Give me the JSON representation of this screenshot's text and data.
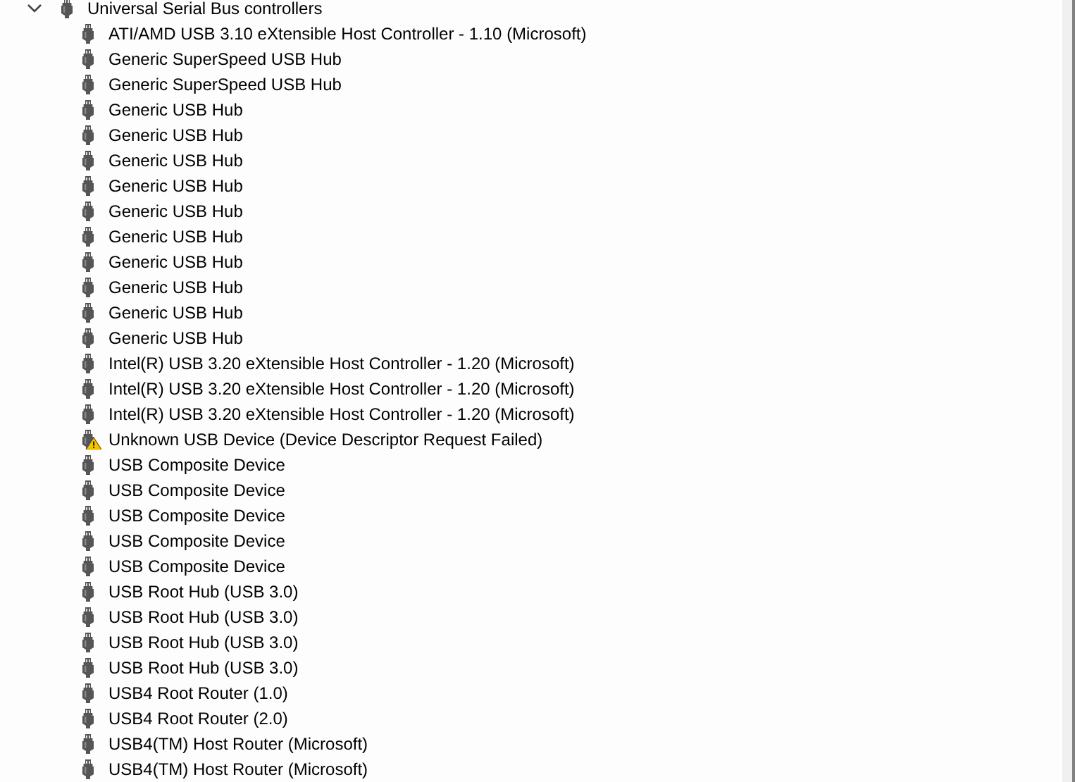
{
  "category": {
    "label": "Universal Serial Bus controllers",
    "expanded": true,
    "children": [
      {
        "label": "ATI/AMD USB 3.10 eXtensible Host Controller - 1.10 (Microsoft)",
        "warning": false
      },
      {
        "label": "Generic SuperSpeed USB Hub",
        "warning": false
      },
      {
        "label": "Generic SuperSpeed USB Hub",
        "warning": false
      },
      {
        "label": "Generic USB Hub",
        "warning": false
      },
      {
        "label": "Generic USB Hub",
        "warning": false
      },
      {
        "label": "Generic USB Hub",
        "warning": false
      },
      {
        "label": "Generic USB Hub",
        "warning": false
      },
      {
        "label": "Generic USB Hub",
        "warning": false
      },
      {
        "label": "Generic USB Hub",
        "warning": false
      },
      {
        "label": "Generic USB Hub",
        "warning": false
      },
      {
        "label": "Generic USB Hub",
        "warning": false
      },
      {
        "label": "Generic USB Hub",
        "warning": false
      },
      {
        "label": "Generic USB Hub",
        "warning": false
      },
      {
        "label": "Intel(R) USB 3.20 eXtensible Host Controller - 1.20 (Microsoft)",
        "warning": false
      },
      {
        "label": "Intel(R) USB 3.20 eXtensible Host Controller - 1.20 (Microsoft)",
        "warning": false
      },
      {
        "label": "Intel(R) USB 3.20 eXtensible Host Controller - 1.20 (Microsoft)",
        "warning": false
      },
      {
        "label": "Unknown USB Device (Device Descriptor Request Failed)",
        "warning": true
      },
      {
        "label": "USB Composite Device",
        "warning": false
      },
      {
        "label": "USB Composite Device",
        "warning": false
      },
      {
        "label": "USB Composite Device",
        "warning": false
      },
      {
        "label": "USB Composite Device",
        "warning": false
      },
      {
        "label": "USB Composite Device",
        "warning": false
      },
      {
        "label": "USB Root Hub (USB 3.0)",
        "warning": false
      },
      {
        "label": "USB Root Hub (USB 3.0)",
        "warning": false
      },
      {
        "label": "USB Root Hub (USB 3.0)",
        "warning": false
      },
      {
        "label": "USB Root Hub (USB 3.0)",
        "warning": false
      },
      {
        "label": "USB4 Root Router (1.0)",
        "warning": false
      },
      {
        "label": "USB4 Root Router (2.0)",
        "warning": false
      },
      {
        "label": "USB4(TM) Host Router (Microsoft)",
        "warning": false
      },
      {
        "label": "USB4(TM) Host Router (Microsoft)",
        "warning": false
      }
    ]
  }
}
